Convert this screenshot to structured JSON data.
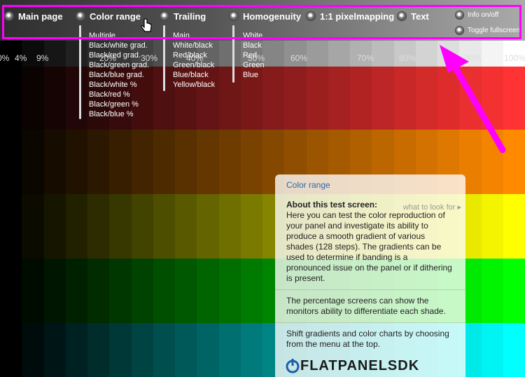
{
  "menu": {
    "items": [
      {
        "label": "Main page"
      },
      {
        "label": "Color range"
      },
      {
        "label": "Trailing"
      },
      {
        "label": "Homogenuity"
      },
      {
        "label": "1:1 pixelmapping"
      },
      {
        "label": "Text"
      }
    ],
    "color_range_sub": [
      "Multiple",
      "Black/white grad.",
      "Black/red grad.",
      "Black/green grad.",
      "Black/blue grad.",
      "Black/white %",
      "Black/red %",
      "Black/green %",
      "Black/blue %"
    ],
    "trailing_sub": [
      "Main",
      "White/black",
      "Red/black",
      "Green/black",
      "Blue/black",
      "Yellow/black"
    ],
    "homogenuity_sub": [
      "White",
      "Black",
      "Red",
      "Green",
      "Blue"
    ],
    "side_options": [
      "Info on/off",
      "Toggle fullscreen"
    ]
  },
  "percent_labels": [
    "0%",
    "4%",
    "9%",
    "20%",
    "30%",
    "40%",
    "50%",
    "60%",
    "70%",
    "80%",
    "90%",
    "100%"
  ],
  "panel": {
    "title": "Color range",
    "heading": "About this test screen:",
    "what_link": "what to look for",
    "para1": "Here you can test the color reproduction of your panel and investigate its ability to produce a smooth gradient of various shades (128 steps). The gradients can be used to determine if banding is a pronounced issue on the panel or if dithering is present.",
    "para2": "The percentage screens can show the monitors ability to differentiate each shade.",
    "para3": "Shift gradients and color charts by choosing from the menu at the top.",
    "logo_main": "FLATPANELS",
    "logo_suffix": "DK"
  },
  "colors": {
    "highlight": "#ff00ff",
    "panel_title": "#2a6aa8",
    "band_red": "#ff3333",
    "band_orange": "#ff8a00",
    "band_yellow": "#ffff00",
    "band_green": "#00ff00",
    "band_cyan": "#00ffff"
  }
}
